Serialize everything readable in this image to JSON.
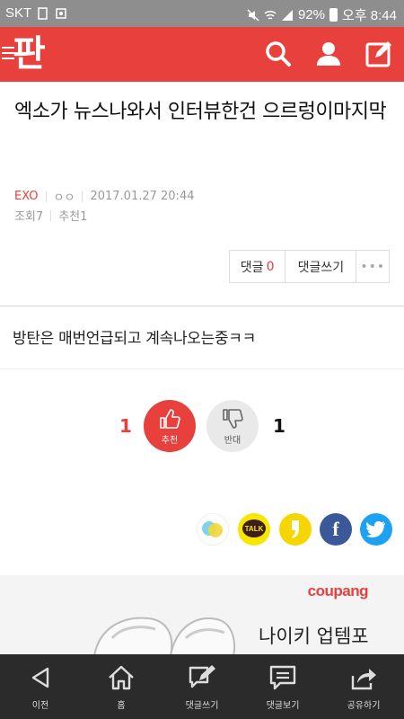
{
  "status_bar": {
    "carrier": "SKT",
    "battery": "92%",
    "time": "오후 8:44"
  },
  "app": {
    "logo": "판"
  },
  "post": {
    "title": "엑소가 뉴스나와서 인터뷰한건 으르렁이마지막",
    "category": "EXO",
    "author": "ㅇㅇ",
    "date": "2017.01.27 20:44",
    "views_label": "조회7",
    "recommend_label": "추천1",
    "body": "방탄은 매번언급되고 계속나오는중ㅋㅋ"
  },
  "comment_box": {
    "comment_label": "댓글",
    "comment_count": "0",
    "write_label": "댓글쓰기",
    "more_label": "•••"
  },
  "votes": {
    "up_count": "1",
    "up_label": "추천",
    "down_count": "1",
    "down_label": "반대"
  },
  "share": {
    "kakao_talk_label": "TALK",
    "facebook_label": "f"
  },
  "ad": {
    "brand": "coupang",
    "text": "나이키 업템포"
  },
  "bottom_nav": [
    {
      "label": "이전",
      "icon": "back-icon"
    },
    {
      "label": "홈",
      "icon": "home-icon"
    },
    {
      "label": "댓글쓰기",
      "icon": "write-comment-icon"
    },
    {
      "label": "댓글보기",
      "icon": "view-comments-icon"
    },
    {
      "label": "공유하기",
      "icon": "share-icon"
    }
  ],
  "colors": {
    "brand": "#e8403d",
    "status_bar": "#8e8e8e",
    "nav_bg": "#2b2b2b"
  }
}
